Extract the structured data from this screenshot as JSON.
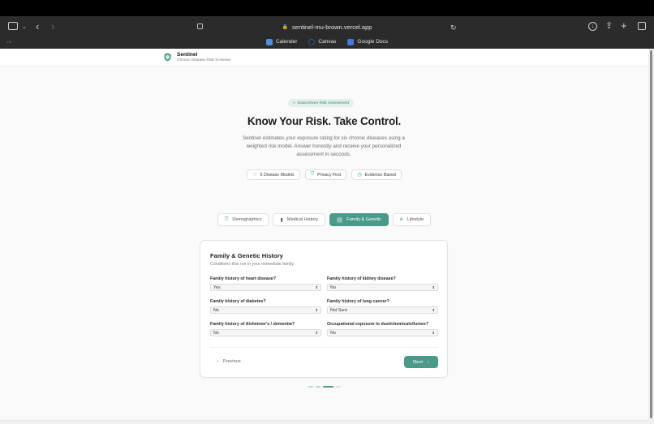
{
  "browser": {
    "url": "sentinel-mu-brown.vercel.app",
    "bookmarks": [
      {
        "label": "Calender",
        "color": "#4a90e2"
      },
      {
        "label": "Canvas",
        "color": "#3a7bd5"
      },
      {
        "label": "Google Docs",
        "color": "#4a78d8"
      }
    ]
  },
  "app": {
    "name": "Sentinel",
    "subtitle": "Chronic Disease Risk Screener"
  },
  "hero": {
    "badge": "Data-Driven Risk Assessment",
    "title": "Know Your Risk. Take Control.",
    "description": "Sentinel estimates your exposure rating for six chronic diseases using a weighted risk model. Answer honestly and receive your personalized assessment in seconds.",
    "pills": [
      {
        "label": "6 Disease Models",
        "icon": "heart-icon"
      },
      {
        "label": "Privacy First",
        "icon": "shield-icon"
      },
      {
        "label": "Evidence Based",
        "icon": "clock-icon"
      }
    ]
  },
  "tabs": [
    {
      "label": "Demographics",
      "icon": "person-icon",
      "active": false
    },
    {
      "label": "Medical History",
      "icon": "medical-icon",
      "active": false
    },
    {
      "label": "Family & Genetic",
      "icon": "dna-icon",
      "active": true
    },
    {
      "label": "Lifestyle",
      "icon": "activity-icon",
      "active": false
    }
  ],
  "form": {
    "title": "Family & Genetic History",
    "subtitle": "Conditions that run in your immediate family.",
    "fields": [
      {
        "label": "Family history of heart disease?",
        "value": "Yes"
      },
      {
        "label": "Family history of kidney disease?",
        "value": "No"
      },
      {
        "label": "Family history of diabetes?",
        "value": "No"
      },
      {
        "label": "Family history of lung cancer?",
        "value": "Not Sure"
      },
      {
        "label": "Family history of Alzheimer's / dementia?",
        "value": "No"
      },
      {
        "label": "Occupational exposure to dust/chemicals/fumes?",
        "value": "No"
      }
    ],
    "previous_label": "Previous",
    "next_label": "Next"
  },
  "progress": {
    "current_step": 3,
    "total_steps": 4
  },
  "colors": {
    "accent": "#4a9a89",
    "badge_bg": "#e2efeb"
  }
}
